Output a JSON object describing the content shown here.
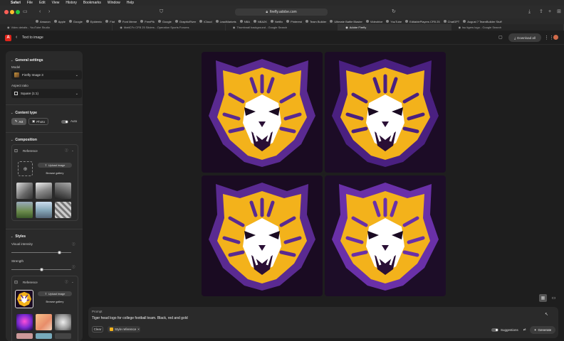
{
  "menubar": {
    "apple": "",
    "items": [
      "Safari",
      "File",
      "Edit",
      "View",
      "History",
      "Bookmarks",
      "Window",
      "Help"
    ]
  },
  "browser": {
    "url": "firefly.adobe.com",
    "favorites": [
      "Amazon",
      "Apple",
      "Google",
      "Epidemic",
      "Flat",
      "Font Meme",
      "FreePik",
      "Google",
      "GraphicRiver",
      "iCloud",
      "LeadMarkets",
      "NBA",
      "NBA2K",
      "Netflix",
      "Pinterest",
      "Team Builder",
      "Ultimate Battle Blaster",
      "Videohive",
      "YouTube",
      "EditablePlayers CFB 25",
      "ChatGPT",
      "August 7 TeamBuilder Stuff"
    ],
    "tabs": [
      {
        "label": "Video details - YouTube Studio",
        "active": false
      },
      {
        "label": "MattCFx CFB 25 Sliders - Operation Sports Forums",
        "active": false
      },
      {
        "label": "Thumbnail background - Google Search",
        "active": false
      },
      {
        "label": "Adobe Firefly",
        "active": true
      },
      {
        "label": "lsu tigers logo - Google Search",
        "active": false
      }
    ]
  },
  "app": {
    "logo": "A",
    "title": "Text to image",
    "download_label": "Download all"
  },
  "panel": {
    "general": {
      "heading": "General settings",
      "model_label": "Model",
      "model_value": "Firefly Image 3",
      "aspect_label": "Aspect ratio",
      "aspect_value": "Square (1:1)"
    },
    "content_type": {
      "heading": "Content type",
      "art": "Art",
      "photo": "Photo",
      "auto": "Auto"
    },
    "composition": {
      "heading": "Composition",
      "reference": "Reference",
      "upload": "Upload image",
      "browse": "Browse gallery"
    },
    "styles": {
      "heading": "Styles",
      "visual_intensity": "Visual intensity",
      "visual_intensity_level": 0.8,
      "strength": "Strength",
      "strength_level": 0.5,
      "reference": "Reference",
      "upload": "Upload image",
      "browse": "Browse gallery"
    }
  },
  "prompt": {
    "label": "Prompt",
    "text": "Tiger head logo for college football team. Black, red and gold",
    "clear": "Clear",
    "style_chip": "Style reference",
    "suggestions": "Suggestions",
    "generate": "Generate"
  },
  "colors": {
    "accent_red": "#e1251b",
    "tiger_gold": "#f3b21b",
    "tiger_purple": "#5a2a91"
  }
}
